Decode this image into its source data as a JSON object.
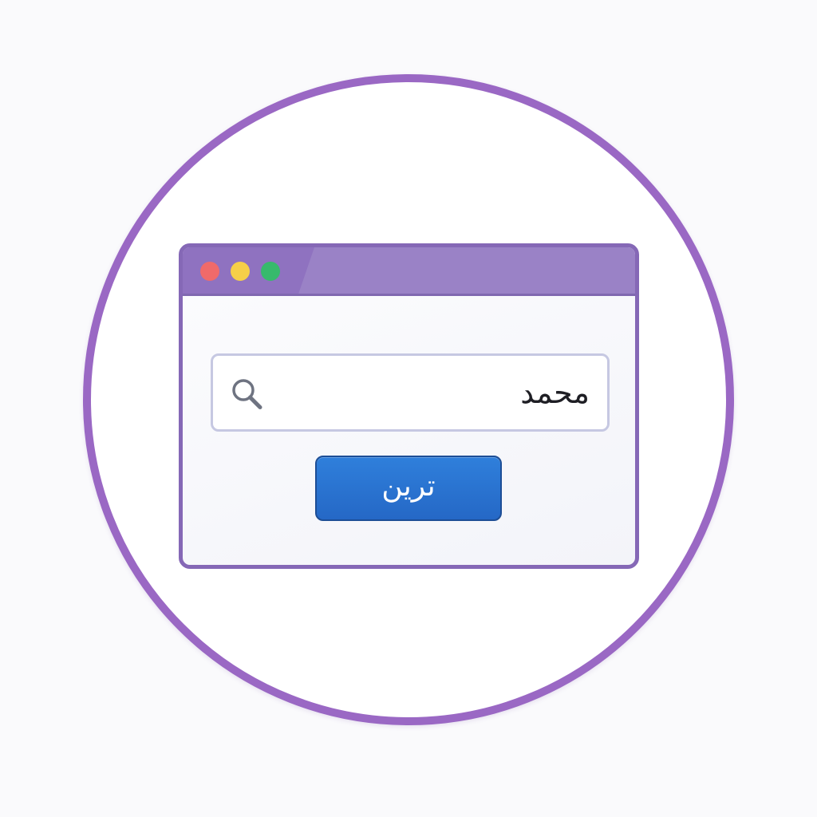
{
  "search": {
    "value": "محمد",
    "icon": "search-icon"
  },
  "button": {
    "label": "ترين"
  },
  "window_controls": {
    "close_color": "#f06a6a",
    "minimize_color": "#f6cf48",
    "maximize_color": "#37ba6c"
  },
  "colors": {
    "accent": "#9a68c4",
    "titlebar": "#9a82c6",
    "button": "#2f7fdb"
  }
}
